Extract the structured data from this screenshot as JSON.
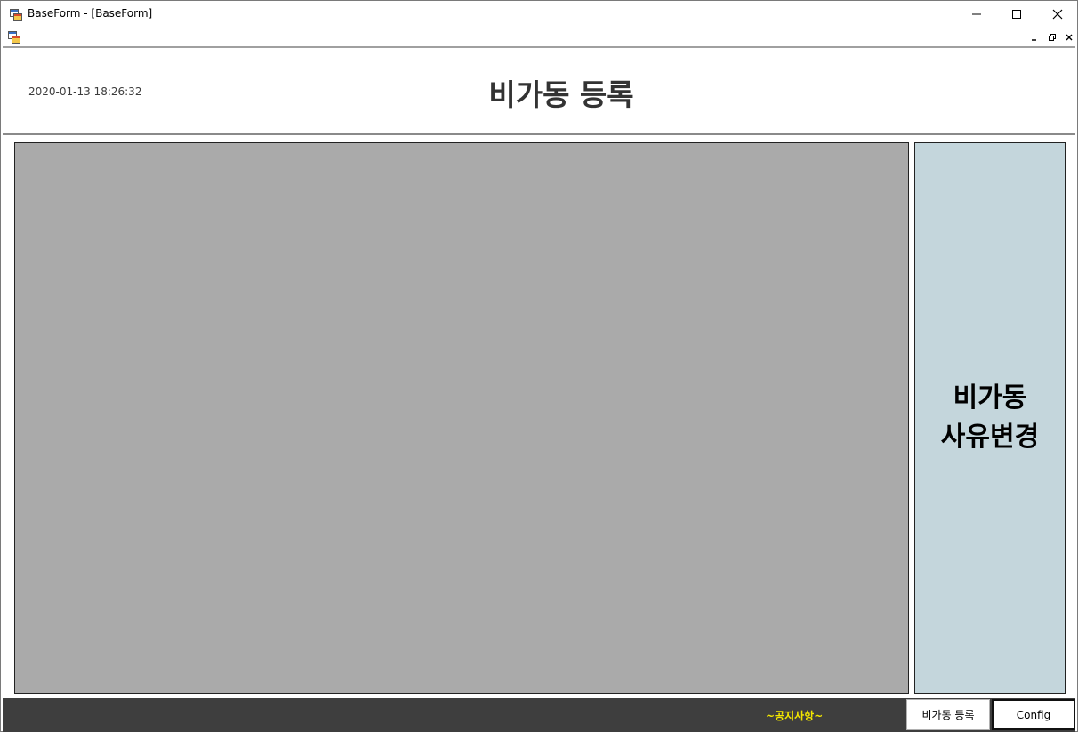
{
  "window": {
    "title": "BaseForm - [BaseForm]"
  },
  "header": {
    "datetime": "2020-01-13 18:26:32",
    "title": "비가동 등록"
  },
  "side_button": {
    "line1": "비가동",
    "line2": "사유변경"
  },
  "footer": {
    "notice": "~공지사항~",
    "register_label": "비가동 등록",
    "config_label": "Config"
  },
  "colors": {
    "content_bg": "#aaaaaa",
    "side_button_bg": "#c4d6dc",
    "footer_bg": "#3e3e3e",
    "notice_text": "#f2e600"
  },
  "icons": {
    "app": "windows-form-icon",
    "minimize": "minimize-icon",
    "maximize": "maximize-icon",
    "close": "close-icon",
    "restore": "restore-icon"
  }
}
